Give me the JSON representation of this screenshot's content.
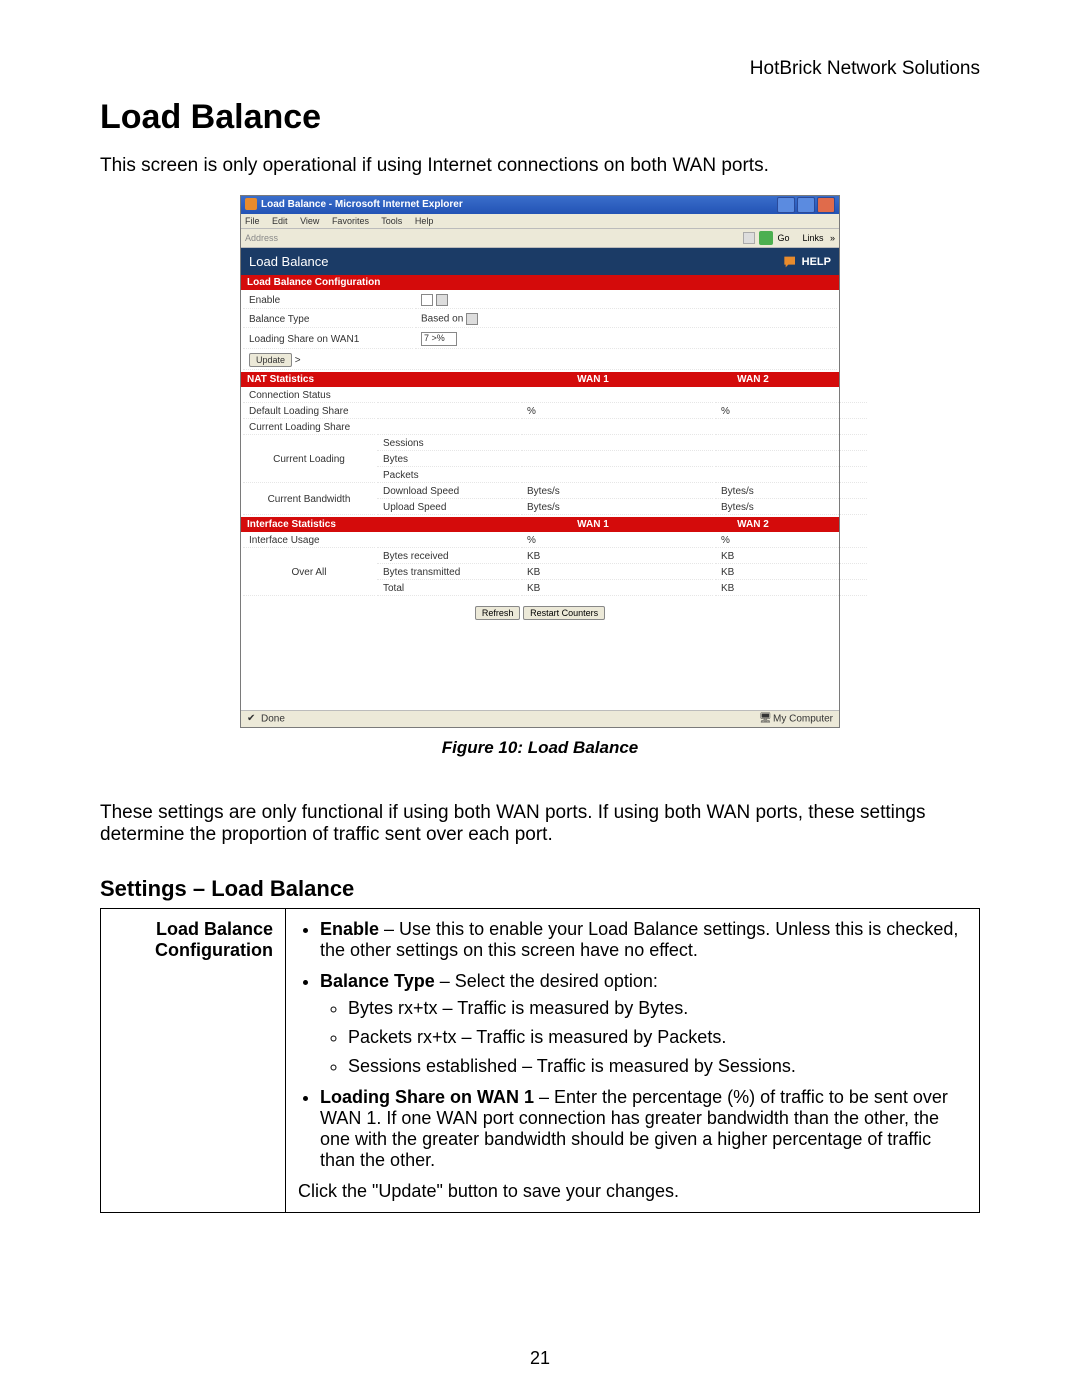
{
  "company": "HotBrick Network Solutions",
  "page_title": "Load Balance",
  "intro": "This screen is only operational if using Internet connections on both WAN ports.",
  "figure_caption": "Figure 10: Load Balance",
  "para2": "These settings are only functional if using both WAN ports. If using both WAN ports, these settings determine the proportion of traffic sent over each port.",
  "section_title": "Settings – Load Balance",
  "settings_row_label": "Load Balance Configuration",
  "settings": {
    "enable_label": "Enable",
    "enable_text": " – Use this to enable your Load Balance settings. Unless this is checked, the other settings on this screen have no effect.",
    "btype_label": "Balance Type",
    "btype_text": " – Select the desired option:",
    "btype_opt1": "Bytes rx+tx – Traffic is measured by Bytes.",
    "btype_opt2": "Packets rx+tx – Traffic is measured by Packets.",
    "btype_opt3": "Sessions established – Traffic is measured by Sessions.",
    "lshare_label": "Loading Share on WAN 1",
    "lshare_text": " – Enter the percentage (%) of traffic to be sent over WAN 1. If one WAN port connection has greater bandwidth than the other, the one with the greater bandwidth should be given a higher percentage of traffic than the other.",
    "click_update": "Click the \"Update\" button to save your changes."
  },
  "page_number": "21",
  "ie": {
    "title": "Load Balance - Microsoft Internet Explorer",
    "menus": [
      "File",
      "Edit",
      "View",
      "Favorites",
      "Tools",
      "Help"
    ],
    "address_label": "Address",
    "go_label": "Go",
    "links_label": "Links",
    "header": "Load Balance",
    "help": "HELP",
    "section_config": "Load Balance Configuration",
    "cfg_enable": "Enable",
    "cfg_btype": "Balance Type",
    "cfg_btype_val": "Based on",
    "cfg_lshare": "Loading Share on WAN1",
    "cfg_lshare_val": "7 >%",
    "update_btn": "Update",
    "section_nat": "NAT Statistics",
    "wan1": "WAN 1",
    "wan2": "WAN 2",
    "conn_status": "Connection Status",
    "def_lshare": "Default Loading Share",
    "cur_lshare": "Current Loading Share",
    "cur_loading": "Current Loading",
    "cur_bandwidth": "Current Bandwidth",
    "sessions": "Sessions",
    "bytes": "Bytes",
    "packets": "Packets",
    "dl_speed": "Download Speed",
    "ul_speed": "Upload Speed",
    "bytes_s": "Bytes/s",
    "pct": "%",
    "section_if": "Interface Statistics",
    "if_usage": "Interface Usage",
    "over_all": "Over All",
    "brx": "Bytes received",
    "btx": "Bytes transmitted",
    "total": "Total",
    "kb": "KB",
    "refresh": "Refresh",
    "restart": "Restart Counters",
    "status_done": "Done",
    "status_zone": "My Computer"
  }
}
